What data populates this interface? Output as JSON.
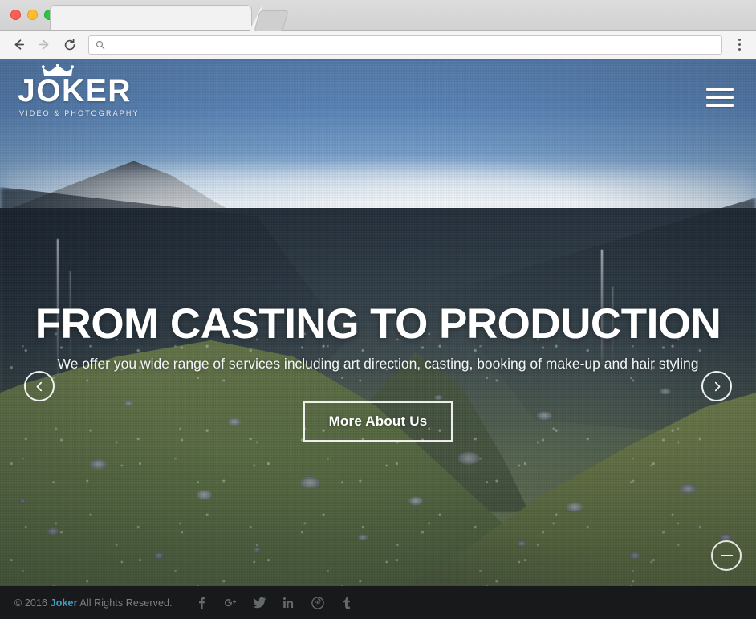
{
  "browser": {
    "back_label": "Back",
    "forward_label": "Forward",
    "reload_label": "Reload",
    "menu_label": "Customize and control",
    "address_value": "",
    "address_placeholder": "",
    "tab_title": ""
  },
  "site": {
    "logo": {
      "word": "JOKER",
      "tagline": "VIDEO & PHOTOGRAPHY"
    },
    "menu_label": "Menu"
  },
  "hero": {
    "title": "FROM CASTING TO PRODUCTION",
    "subtitle": "We offer you wide range of services including art direction, casting, booking of make-up and hair styling",
    "cta_label": "More About Us",
    "prev_label": "Previous slide",
    "next_label": "Next slide",
    "scroll_label": "Scroll down"
  },
  "footer": {
    "copyright_prefix": "© 2016 ",
    "brand": "Joker",
    "copyright_suffix": " All Rights Reserved.",
    "social": [
      {
        "name": "facebook",
        "label": "Facebook"
      },
      {
        "name": "googleplus",
        "label": "Google Plus"
      },
      {
        "name": "twitter",
        "label": "Twitter"
      },
      {
        "name": "linkedin",
        "label": "LinkedIn"
      },
      {
        "name": "pinterest",
        "label": "Pinterest"
      },
      {
        "name": "tumblr",
        "label": "Tumblr"
      }
    ]
  },
  "colors": {
    "accent": "#3f9bc4",
    "footer_bg": "#17191b",
    "footer_text": "#7c8184",
    "hero_text": "#ffffff",
    "toolbar_accent": "#4a6fa5"
  }
}
